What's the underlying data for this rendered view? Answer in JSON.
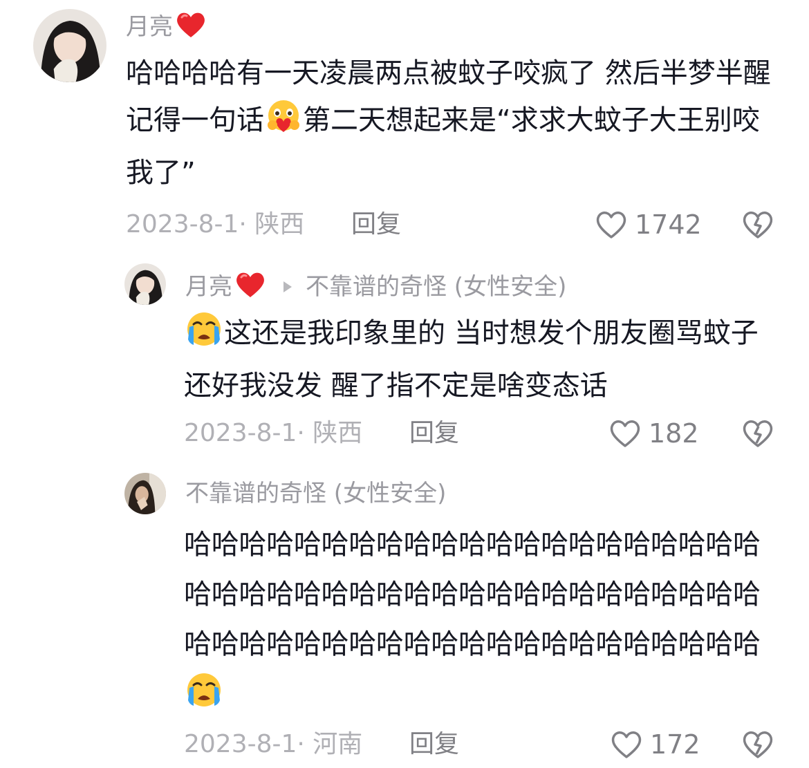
{
  "comments": [
    {
      "username": "月亮",
      "text_parts": [
        "哈哈哈哈有一天凌晨两点被蚊子咬疯了 然后半梦半醒记得一句话",
        "第二天想起来是“求求大蚊子大王别咬我了”"
      ],
      "date_location": "2023-8-1· 陕西",
      "reply_label": "回复",
      "likes": "1742"
    },
    {
      "username": "月亮",
      "reply_to": "不靠谱的奇怪 (女性安全)",
      "text": "这还是我印象里的 当时想发个朋友圈骂蚊子 还好我没发 醒了指不定是啥变态话",
      "date_location": "2023-8-1· 陕西",
      "reply_label": "回复",
      "likes": "182"
    },
    {
      "username": "不靠谱的奇怪 (女性安全)",
      "text": "哈哈哈哈哈哈哈哈哈哈哈哈哈哈哈哈哈哈哈哈哈哈哈哈哈哈哈哈哈哈哈哈哈哈哈哈哈哈哈哈哈哈哈哈哈哈哈哈哈哈哈哈哈哈哈哈哈哈哈哈哈哈哈",
      "date_location": "2023-8-1· 河南",
      "reply_label": "回复",
      "likes": "172"
    }
  ],
  "icons": {
    "heart_emoji": "red-heart-emoji",
    "hugging_emoji": "hugging-face-emoji",
    "crying_emoji": "loudly-crying-face-emoji",
    "like": "heart-outline-icon",
    "dislike": "broken-heart-outline-icon",
    "reply_arrow": "play-arrow-icon"
  },
  "colors": {
    "heart_red": "#e8262d",
    "text_primary": "#161823",
    "text_muted": "#b0b0b5"
  }
}
